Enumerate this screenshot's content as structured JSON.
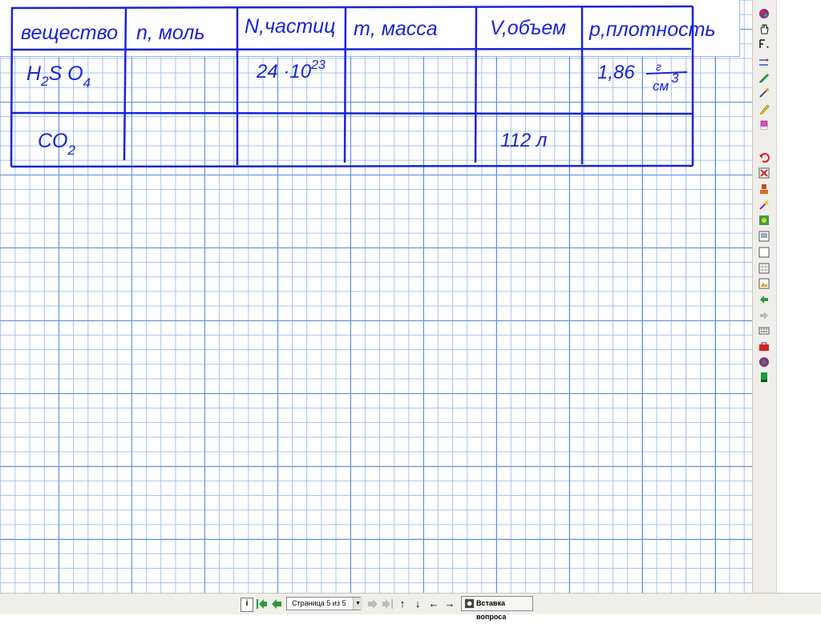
{
  "table": {
    "headers": [
      "вещество",
      "n, моль",
      "N,частиц",
      "m, масса",
      "V,объем",
      "p,плотность"
    ],
    "rows": [
      {
        "substance": {
          "parts": [
            "H",
            "2",
            "S O",
            "4"
          ]
        },
        "n": "",
        "N": {
          "mantissa": "24 ·10",
          "exponent": "23"
        },
        "m": "",
        "V": "",
        "p": {
          "value": "1,86",
          "unit_num": "г",
          "unit_den": "см",
          "unit_den_exp": "3"
        }
      },
      {
        "substance": {
          "parts": [
            "CO",
            "2"
          ]
        },
        "n": "",
        "N": "",
        "m": "",
        "V": "112  л",
        "p": ""
      }
    ]
  },
  "toolbar": {
    "tools": [
      "color-picker-icon",
      "hand-icon",
      "text-tool-icon",
      "line-tool-icon",
      "pen-icon",
      "magic-pen-icon",
      "highlighter-icon",
      "eraser-icon",
      "undo-icon",
      "delete-icon",
      "stamp-icon",
      "magic-wand-icon",
      "gallery-icon",
      "screen-shade-icon",
      "blank-page-icon",
      "grid-page-icon",
      "picture-page-icon",
      "prev-page-icon",
      "next-page-icon",
      "keyboard-icon",
      "toolbox-icon",
      "recorder-icon",
      "green-bar-icon"
    ]
  },
  "statusbar": {
    "page_label": "Страница 5 из 5",
    "insert_question_label": "Вставка вопроса",
    "info_icon": "info-icon",
    "first_page_icon": "first-page-icon",
    "prev_page_icon": "prev-page-arrow-icon",
    "next_page_icon": "next-page-arrow-icon",
    "last_page_icon": "last-page-icon",
    "move_up_icon": "arrow-up-icon",
    "move_down_icon": "arrow-down-icon",
    "move_left_icon": "arrow-left-icon",
    "move_right_icon": "arrow-right-icon"
  },
  "colors": {
    "ink": "#1a24d6",
    "grid_major": "#568cde",
    "grid_minor": "#8cb4ec"
  }
}
